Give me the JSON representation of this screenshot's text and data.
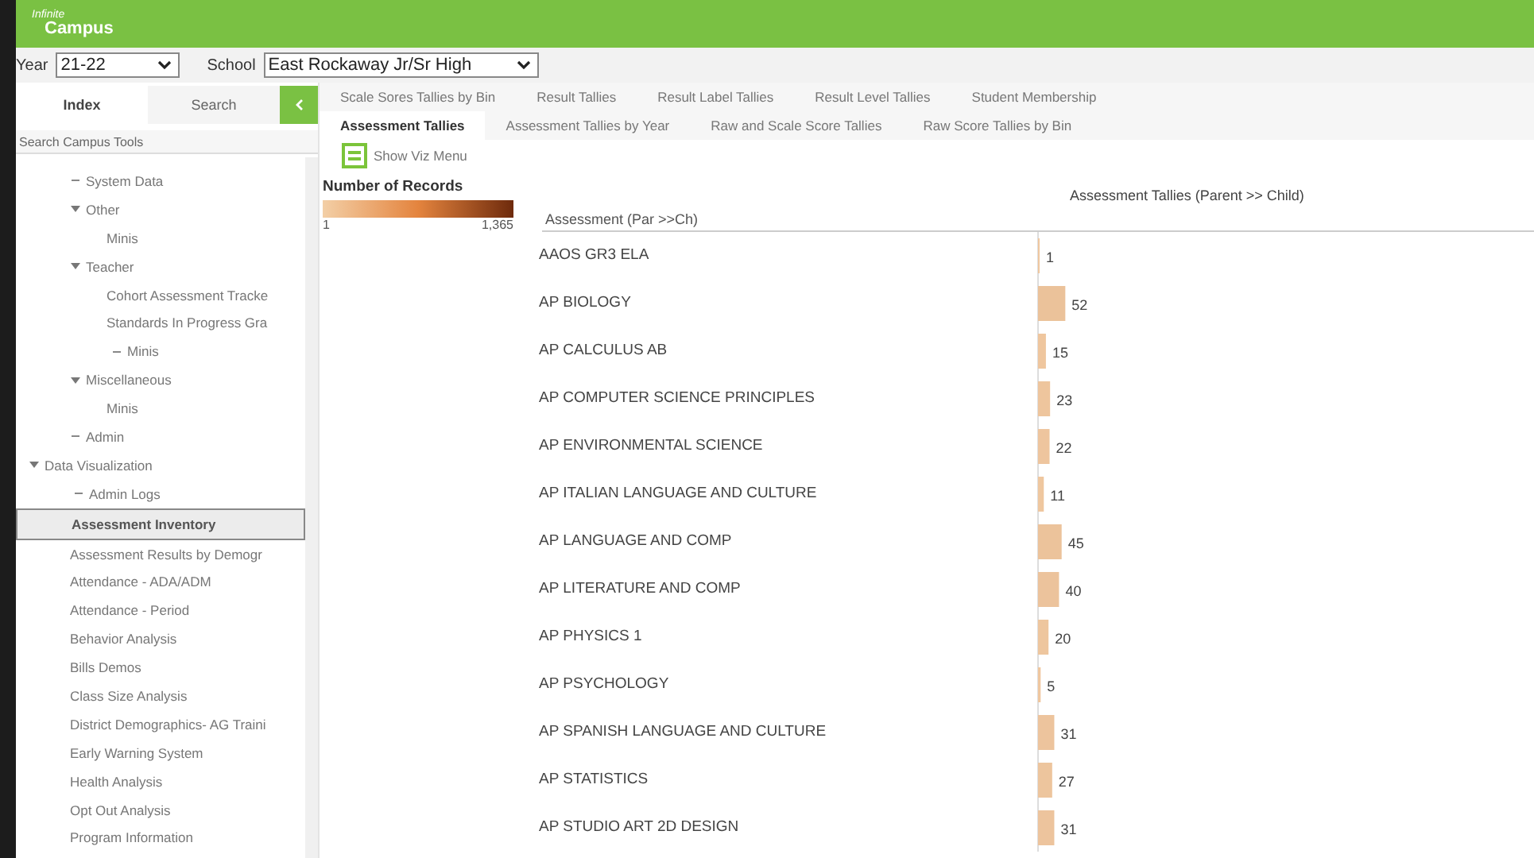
{
  "logo": {
    "line1": "Infinite",
    "line2": "Campus"
  },
  "context": {
    "year_label": "Year",
    "year": "21-22",
    "school_label": "School",
    "school": "East Rockaway Jr/Sr High"
  },
  "sidebar": {
    "tabs": [
      {
        "label": "Index",
        "selected": true
      },
      {
        "label": "Search",
        "selected": false
      }
    ],
    "search": {
      "placeholder": "Search Campus Tools"
    },
    "tree_above": [
      {
        "label": "System Data",
        "expanded": false,
        "selected": false
      },
      {
        "label": "Other",
        "expanded": true,
        "selected": false,
        "children": [
          {
            "label": "Minis",
            "selected": false
          }
        ]
      },
      {
        "label": "Teacher",
        "expanded": true,
        "selected": false,
        "children": [
          {
            "label": "Cohort Assessment Tracke",
            "selected": false
          },
          {
            "label": "Standards In Progress Gra",
            "selected": false
          },
          {
            "label": "Minis",
            "expanded": false,
            "selected": false
          }
        ]
      },
      {
        "label": "Miscellaneous",
        "expanded": true,
        "selected": false,
        "children": [
          {
            "label": "Minis",
            "selected": false
          }
        ]
      },
      {
        "label": "Admin",
        "expanded": false,
        "selected": false
      }
    ],
    "tree": [
      {
        "label": "Data Visualization",
        "expanded": true,
        "selected": false,
        "children": [
          {
            "label": "Admin Logs",
            "expanded": false,
            "selected": false
          },
          {
            "label": "Assessment Inventory",
            "selected": true
          },
          {
            "label": "Assessment Results by Demogr",
            "selected": false
          },
          {
            "label": "Attendance - ADA/ADM",
            "selected": false
          },
          {
            "label": "Attendance - Period",
            "selected": false
          },
          {
            "label": "Behavior Analysis",
            "selected": false
          },
          {
            "label": "Bills Demos",
            "selected": false
          },
          {
            "label": "Class Size Analysis",
            "selected": false
          },
          {
            "label": "District Demographics- AG Traini",
            "selected": false
          },
          {
            "label": "Early Warning System",
            "selected": false
          },
          {
            "label": "Health Analysis",
            "selected": false
          },
          {
            "label": "Opt Out Analysis",
            "selected": false
          },
          {
            "label": "Program Information",
            "selected": false
          }
        ]
      }
    ]
  },
  "tabs_row_1": [
    {
      "label": "Scale Sores Tallies by Bin",
      "selected": false
    },
    {
      "label": "Result Tallies",
      "selected": false
    },
    {
      "label": "Result Label Tallies",
      "selected": false
    },
    {
      "label": "Result Level Tallies",
      "selected": false
    },
    {
      "label": "Student Membership",
      "selected": false
    }
  ],
  "tabs_row_2": [
    {
      "label": "Assessment Tallies",
      "selected": true
    },
    {
      "label": "Assessment Tallies by Year",
      "selected": false
    },
    {
      "label": "Raw and Scale Score Tallies",
      "selected": false
    },
    {
      "label": "Raw Score Tallies by Bin",
      "selected": false
    }
  ],
  "viz_menu": {
    "label": "Show Viz Menu"
  },
  "legend": {
    "title": "Number of Records",
    "min": "1",
    "max": "1,365"
  },
  "chart_title": "Assessment Tallies (Parent >> Child)",
  "column_header": "Assessment (Par >>Ch)",
  "chart_data": {
    "type": "bar",
    "orientation": "horizontal",
    "data_labels": true,
    "categories": [
      "AAOS GR3 ELA",
      "AP BIOLOGY",
      "AP CALCULUS AB",
      "AP COMPUTER SCIENCE PRINCIPLES",
      "AP ENVIRONMENTAL SCIENCE",
      "AP ITALIAN LANGUAGE AND CULTURE",
      "AP LANGUAGE AND COMP",
      "AP LITERATURE AND COMP",
      "AP PHYSICS 1",
      "AP PSYCHOLOGY",
      "AP SPANISH LANGUAGE AND CULTURE",
      "AP STATISTICS",
      "AP STUDIO ART 2D DESIGN"
    ],
    "values": [
      1,
      52,
      15,
      23,
      22,
      11,
      45,
      40,
      20,
      5,
      31,
      27,
      31
    ]
  }
}
